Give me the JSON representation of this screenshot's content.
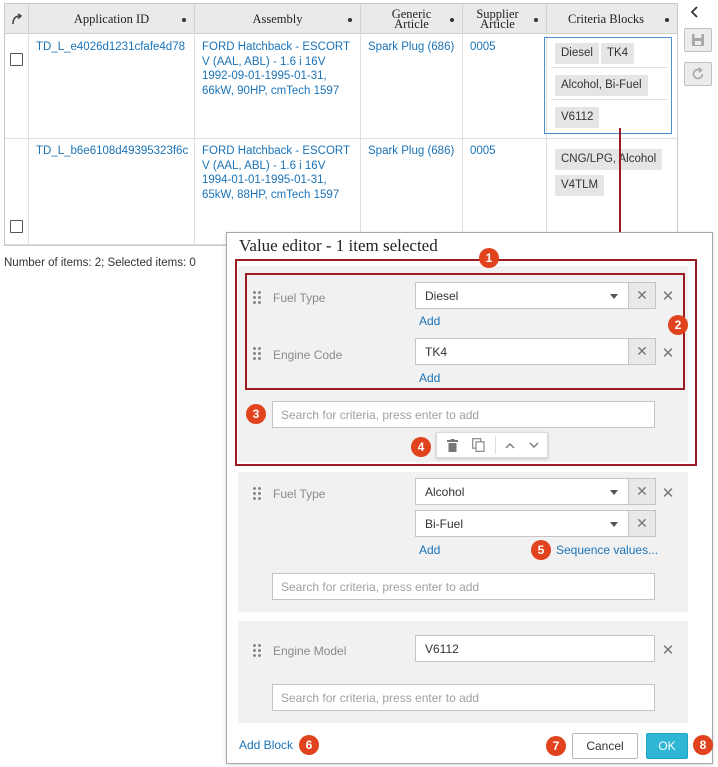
{
  "table": {
    "columns": [
      "Application ID",
      "Assembly",
      "Generic Article",
      "Supplier Article",
      "Criteria Blocks"
    ],
    "rows": [
      {
        "app_id": "TD_L_e4026d1231cfafe4d78",
        "assembly": [
          "FORD Hatchback - ESCORT",
          "V (AAL, ABL) - 1.6 i 16V",
          "1992-09-01-1995-01-31,",
          "66kW, 90HP, cmTech 1597"
        ],
        "generic_article": "Spark Plug (686)",
        "supplier_article": "0005",
        "criteria": {
          "b1": [
            "Diesel",
            "TK4"
          ],
          "b2": [
            "Alcohol, Bi-Fuel"
          ],
          "b3": [
            "V6112"
          ]
        }
      },
      {
        "app_id": "TD_L_b6e6108d49395323f6c",
        "assembly": [
          "FORD Hatchback - ESCORT",
          "V (AAL, ABL) - 1.6 i 16V",
          "1994-01-01-1995-01-31,",
          "65kW, 88HP, cmTech 1597"
        ],
        "generic_article": "Spark Plug (686)",
        "supplier_article": "0005",
        "criteria": {
          "b1": [
            "CNG/LPG, Alcohol"
          ],
          "b2": [
            "V4TLM"
          ]
        }
      }
    ]
  },
  "status": "Number of items: 2; Selected items: 0",
  "editor": {
    "title": "Value editor - 1 item selected",
    "blocks": [
      {
        "rows": [
          {
            "label": "Fuel Type",
            "values": [
              "Diesel"
            ],
            "add": "Add"
          },
          {
            "label": "Engine Code",
            "values": [
              "TK4"
            ],
            "add": "Add"
          }
        ],
        "search_placeholder": "Search for criteria, press enter to add"
      },
      {
        "rows": [
          {
            "label": "Fuel Type",
            "values": [
              "Alcohol",
              "Bi-Fuel"
            ],
            "add": "Add",
            "sequence": "Sequence values..."
          }
        ],
        "search_placeholder": "Search for criteria, press enter to add"
      },
      {
        "rows": [
          {
            "label": "Engine Model",
            "values": [
              "V6112"
            ]
          }
        ],
        "search_placeholder": "Search for criteria, press enter to add"
      }
    ],
    "add_block": "Add Block",
    "cancel": "Cancel",
    "ok": "OK"
  },
  "badges": [
    "1",
    "2",
    "3",
    "4",
    "5",
    "6",
    "7",
    "8"
  ],
  "colors": {
    "link": "#1a73b8",
    "badge": "#e0431d",
    "highlight": "#9b1b22",
    "ok": "#2fb6d4"
  }
}
